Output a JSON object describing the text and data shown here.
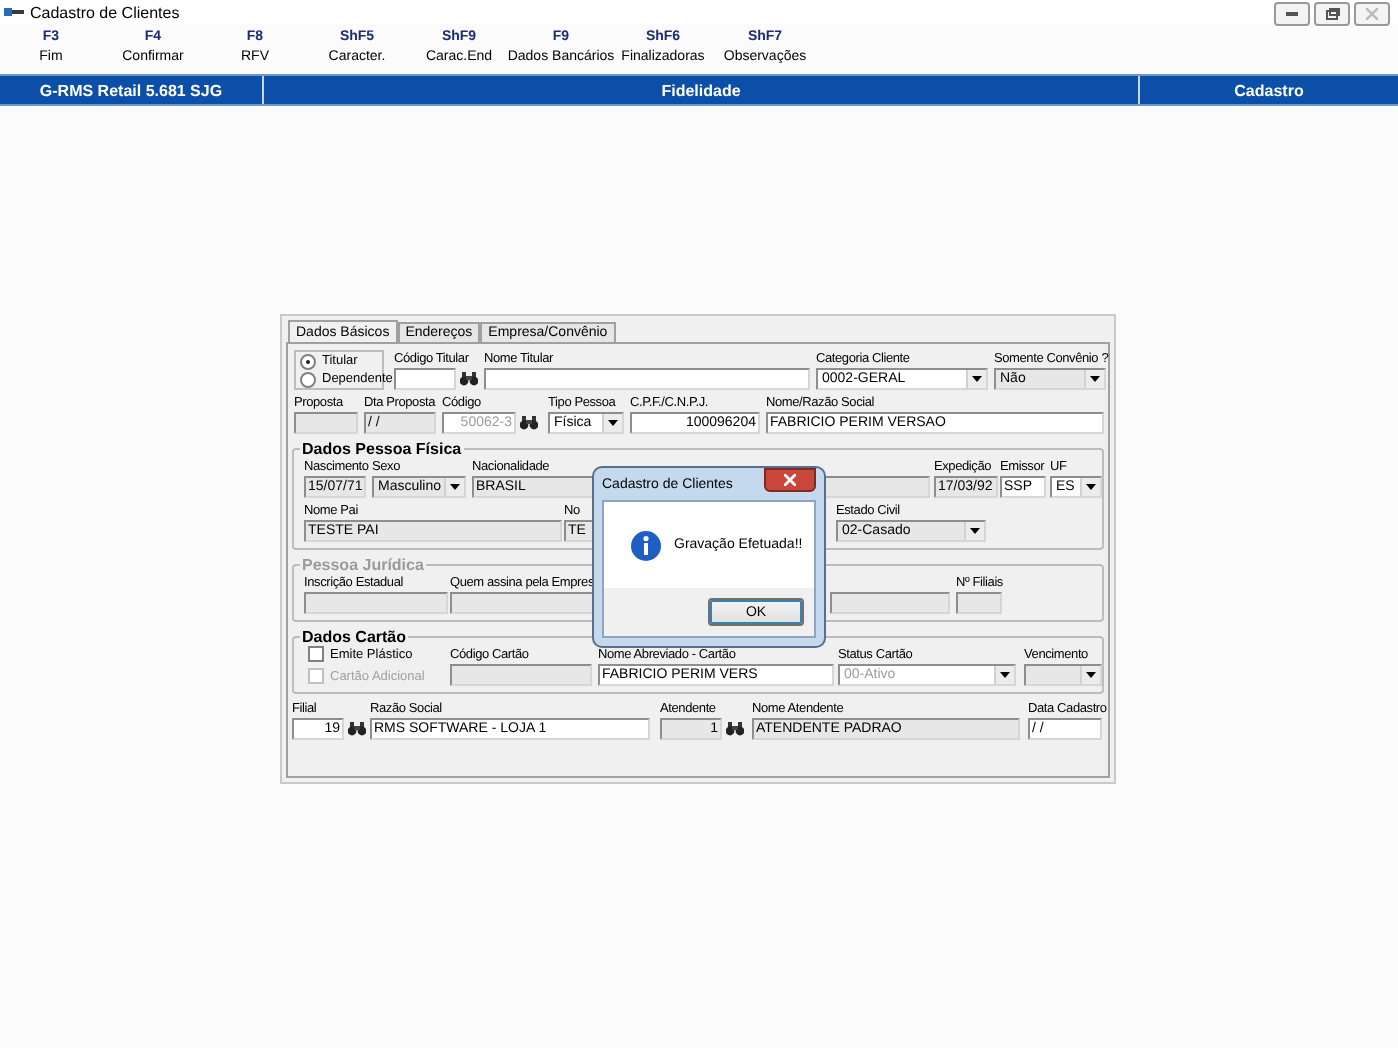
{
  "window": {
    "title": "Cadastro de Clientes"
  },
  "toolbar": [
    {
      "key": "F3",
      "label": "Fim"
    },
    {
      "key": "F4",
      "label": "Confirmar"
    },
    {
      "key": "F8",
      "label": "RFV"
    },
    {
      "key": "ShF5",
      "label": "Caracter."
    },
    {
      "key": "ShF9",
      "label": "Carac.End"
    },
    {
      "key": "F9",
      "label": "Dados Bancários"
    },
    {
      "key": "ShF6",
      "label": "Finalizadoras"
    },
    {
      "key": "ShF7",
      "label": "Observações"
    }
  ],
  "header_bar": [
    "G-RMS Retail 5.681 SJG",
    "Fidelidade",
    "Cadastro"
  ],
  "tabs": [
    {
      "label": "Dados Básicos",
      "selected": true
    },
    {
      "label": "Endereços",
      "selected": false
    },
    {
      "label": "Empresa/Convênio",
      "selected": false
    }
  ],
  "sections": [
    {
      "kind": "plain",
      "lines": [
        {
          "fields": [
            {
              "kind": "radios",
              "options": [
                {
                  "label": "Titular",
                  "selected": true
                },
                {
                  "label": "Dependente",
                  "selected": false
                }
              ]
            },
            {
              "kind": "search",
              "label": "Código Titular"
            },
            {
              "kind": "text",
              "label": "Nome Titular"
            },
            {
              "kind": "select",
              "label": "Categoria Cliente",
              "value": "0002-GERAL"
            },
            {
              "kind": "select",
              "label": "Somente Convênio ?",
              "value": "Não",
              "readonly": true
            }
          ]
        },
        {
          "fields": [
            {
              "kind": "text",
              "label": "Proposta",
              "readonly": true
            },
            {
              "kind": "text",
              "label": "Dta Proposta",
              "value": " / /",
              "readonly": true
            },
            {
              "kind": "search",
              "label": "Código",
              "value": "50062-3",
              "disabled": true
            },
            {
              "kind": "select",
              "label": "Tipo Pessoa",
              "value": "Física"
            },
            {
              "kind": "number",
              "label": "C.P.F./C.N.P.J.",
              "value": "100096204"
            },
            {
              "kind": "text",
              "label": "Nome/Razão Social",
              "value": "FABRICIO PERIM VERSAO"
            }
          ]
        }
      ]
    },
    {
      "kind": "group",
      "title": "Dados Pessoa Física",
      "disabled": false,
      "lines": [
        {
          "fields": [
            {
              "kind": "text",
              "label": "Nascimento",
              "value": "15/07/71",
              "readonly": true
            },
            {
              "kind": "select",
              "label": "Sexo",
              "value": "Masculino",
              "readonly": true
            },
            {
              "kind": "text",
              "label": "Nacionalidade",
              "value": "BRASIL",
              "readonly": true
            },
            {
              "kind": "text",
              "readonly": true
            },
            {
              "kind": "text",
              "label": "Expedição",
              "value": "17/03/92",
              "readonly": true
            },
            {
              "kind": "text",
              "label": "Emissor",
              "value": "SSP"
            },
            {
              "kind": "select",
              "label": "UF",
              "value": "ES"
            }
          ]
        },
        {
          "fields": [
            {
              "kind": "text",
              "label": "Nome Pai",
              "value": "TESTE PAI",
              "readonly": true
            },
            {
              "kind": "text",
              "label": "No",
              "value": "TE",
              "readonly": true
            },
            {
              "kind": "select",
              "label": "Estado Civil",
              "value": "02-Casado",
              "readonly": true
            }
          ]
        }
      ]
    },
    {
      "kind": "group",
      "title": "Pessoa Jurídica",
      "disabled": true,
      "lines": [
        {
          "fields": [
            {
              "kind": "text",
              "label": "Inscrição Estadual",
              "readonly": true
            },
            {
              "kind": "text",
              "label": "Quem assina pela Empres",
              "readonly": true
            },
            {
              "kind": "text",
              "readonly": true
            },
            {
              "kind": "text",
              "label": "Nº Filiais",
              "readonly": true
            }
          ]
        }
      ]
    },
    {
      "kind": "group",
      "title": "Dados Cartão",
      "disabled": false,
      "lines": [
        {
          "fields": [
            {
              "kind": "checks",
              "options": [
                {
                  "label": "Emite Plástico",
                  "checked": false,
                  "disabled": false
                },
                {
                  "label": "Cartão Adicional",
                  "checked": false,
                  "disabled": true
                }
              ]
            },
            {
              "kind": "text",
              "label": "Código Cartão",
              "readonly": true
            },
            {
              "kind": "text",
              "label": "Nome Abreviado - Cartão",
              "value": "FABRICIO PERIM VERS"
            },
            {
              "kind": "select",
              "label": "Status Cartão",
              "value": "00-Ativo",
              "disabled": true
            },
            {
              "kind": "select",
              "label": "Vencimento",
              "readonly": true
            }
          ]
        }
      ]
    },
    {
      "kind": "plain",
      "lines": [
        {
          "fields": [
            {
              "kind": "search",
              "label": "Filial",
              "value": "19"
            },
            {
              "kind": "text",
              "label": "Razão Social",
              "value": "RMS SOFTWARE - LOJA 1"
            },
            {
              "kind": "search",
              "label": "Atendente",
              "value": "1",
              "readonly": true
            },
            {
              "kind": "text",
              "label": "Nome Atendente",
              "value": "ATENDENTE PADRAO",
              "readonly": true
            },
            {
              "kind": "text",
              "label": "Data Cadastro",
              "value": " / /"
            }
          ]
        }
      ]
    }
  ],
  "dialog": {
    "title": "Cadastro de Clientes",
    "message": "Gravação Efetuada!!",
    "button": "OK"
  }
}
